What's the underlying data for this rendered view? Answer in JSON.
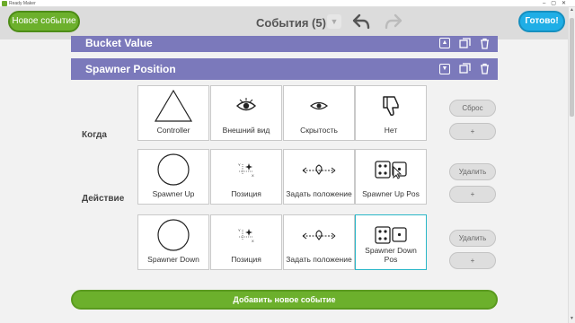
{
  "window": {
    "title": "Ready Maker"
  },
  "toolbar": {
    "new_event_label": "Новое событие",
    "title": "События (5)",
    "done_label": "Готово!"
  },
  "events": [
    {
      "name": "Bucket Value"
    },
    {
      "name": "Spawner Position"
    }
  ],
  "rows": {
    "when_label": "Когда",
    "action_label": "Действие"
  },
  "when_cards": [
    "Controller",
    "Внешний вид",
    "Скрытость",
    "Нет"
  ],
  "action1_cards": [
    "Spawner Up",
    "Позиция",
    "Задать положение",
    "Spawner Up Pos"
  ],
  "action2_cards": [
    "Spawner Down",
    "Позиция",
    "Задать положение",
    "Spawner Down Pos"
  ],
  "side": {
    "reset_label": "Сброс",
    "plus_label": "+",
    "delete_label": "Удалить"
  },
  "footer": {
    "add_event_label": "Добавить новое событие"
  },
  "colors": {
    "accent_green": "#6cb02c",
    "accent_blue": "#1faee6",
    "event_header": "#7b79bb",
    "selected_border": "#2ab7c8"
  }
}
